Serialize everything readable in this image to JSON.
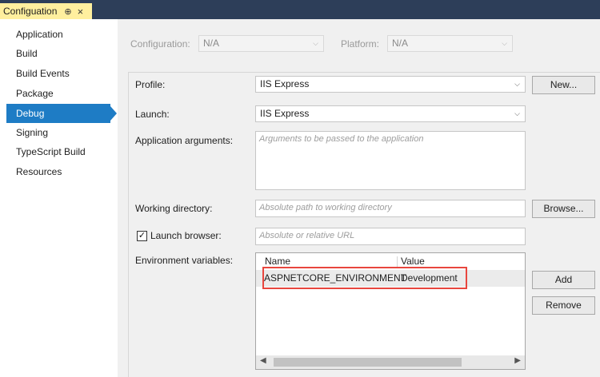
{
  "tab": {
    "title": "Configuation",
    "pin_glyph": "⊕",
    "close_glyph": "×"
  },
  "sidebar": {
    "items": [
      {
        "label": "Application"
      },
      {
        "label": "Build"
      },
      {
        "label": "Build Events"
      },
      {
        "label": "Package"
      },
      {
        "label": "Debug"
      },
      {
        "label": "Signing"
      },
      {
        "label": "TypeScript Build"
      },
      {
        "label": "Resources"
      }
    ],
    "active": "Debug"
  },
  "config_bar": {
    "configuration_label": "Configuration:",
    "configuration_value": "N/A",
    "platform_label": "Platform:",
    "platform_value": "N/A"
  },
  "debug": {
    "profile_label": "Profile:",
    "profile_value": "IIS Express",
    "new_button": "New...",
    "launch_label": "Launch:",
    "launch_value": "IIS Express",
    "app_args_label": "Application arguments:",
    "app_args_placeholder": "Arguments to be passed to the application",
    "working_dir_label": "Working directory:",
    "working_dir_placeholder": "Absolute path to working directory",
    "browse_button": "Browse...",
    "launch_browser_label": "Launch browser:",
    "launch_browser_checked": true,
    "launch_browser_placeholder": "Absolute or relative URL",
    "env_vars_label": "Environment variables:",
    "env_columns": [
      "Name",
      "Value"
    ],
    "env_rows": [
      {
        "name": "ASPNETCORE_ENVIRONMENT",
        "value": "Development"
      }
    ],
    "add_button": "Add",
    "remove_button": "Remove"
  },
  "colors": {
    "accent": "#1e7cc5",
    "highlight": "#e8463e",
    "tab_bg": "#ffef9e",
    "strip": "#2d3e59"
  }
}
